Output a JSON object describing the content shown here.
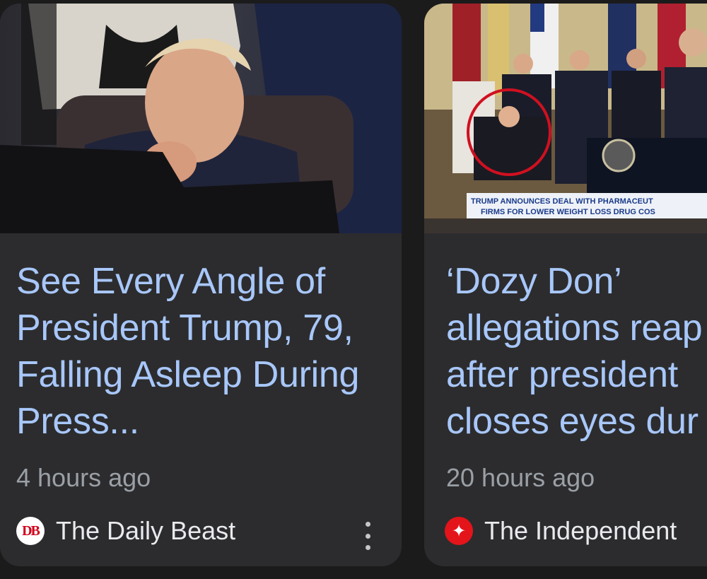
{
  "cards": [
    {
      "headline": "See Every Angle of President Trump, 79, Falling Asleep During Press...",
      "time": "4 hours ago",
      "source": "The Daily Beast",
      "source_logo_text": "DB",
      "menu_icon": "more-vert-icon"
    },
    {
      "headline": "‘Dozy Don’ allegations reap after president closes eyes dur",
      "time": "20 hours ago",
      "source": "The Independent",
      "source_logo_icon": "eagle-icon",
      "chyron_line1": "TRUMP ANNOUNCES DEAL WITH PHARMACEUT",
      "chyron_line2": "FIRMS FOR LOWER WEIGHT LOSS DRUG COS"
    }
  ],
  "colors": {
    "background": "#1b1b1c",
    "card": "#2c2c2e",
    "headline": "#a8c7fa",
    "meta": "#9aa0a6",
    "source": "#e8eaed"
  }
}
